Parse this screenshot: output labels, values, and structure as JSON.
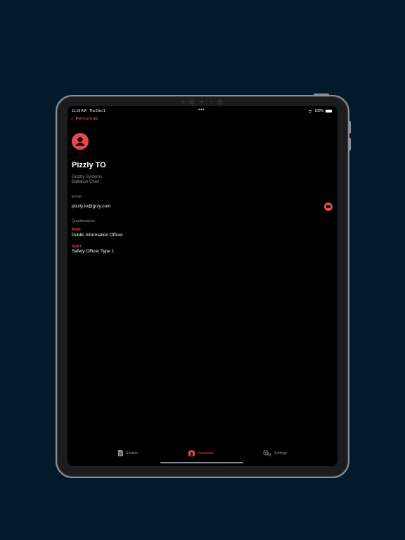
{
  "status": {
    "time": "11:19 AM",
    "date": "Thu Dec 1",
    "dots": "•••",
    "battery": "100%"
  },
  "nav": {
    "back_label": "Personnel"
  },
  "person": {
    "name": "Pizzly TO",
    "organization": "Grizzly Systems",
    "title": "Battalion Chief"
  },
  "email": {
    "label": "Email",
    "value": "pizzly.to@grzy.com"
  },
  "qualifications": {
    "label": "Qualifications",
    "items": [
      {
        "code": "PIOF",
        "name": "Public Information Officer"
      },
      {
        "code": "SOFT",
        "name": "Safety Officer Type 1"
      }
    ]
  },
  "tabs": [
    {
      "label": "Rosters",
      "icon": "document-icon",
      "active": false
    },
    {
      "label": "Personnel",
      "icon": "person-badge-icon",
      "active": true
    },
    {
      "label": "Settings",
      "icon": "gears-icon",
      "active": false
    }
  ],
  "colors": {
    "accent": "#e5484d",
    "background": "#021a2c",
    "screen": "#000000",
    "secondary_text": "#8e8e93"
  }
}
